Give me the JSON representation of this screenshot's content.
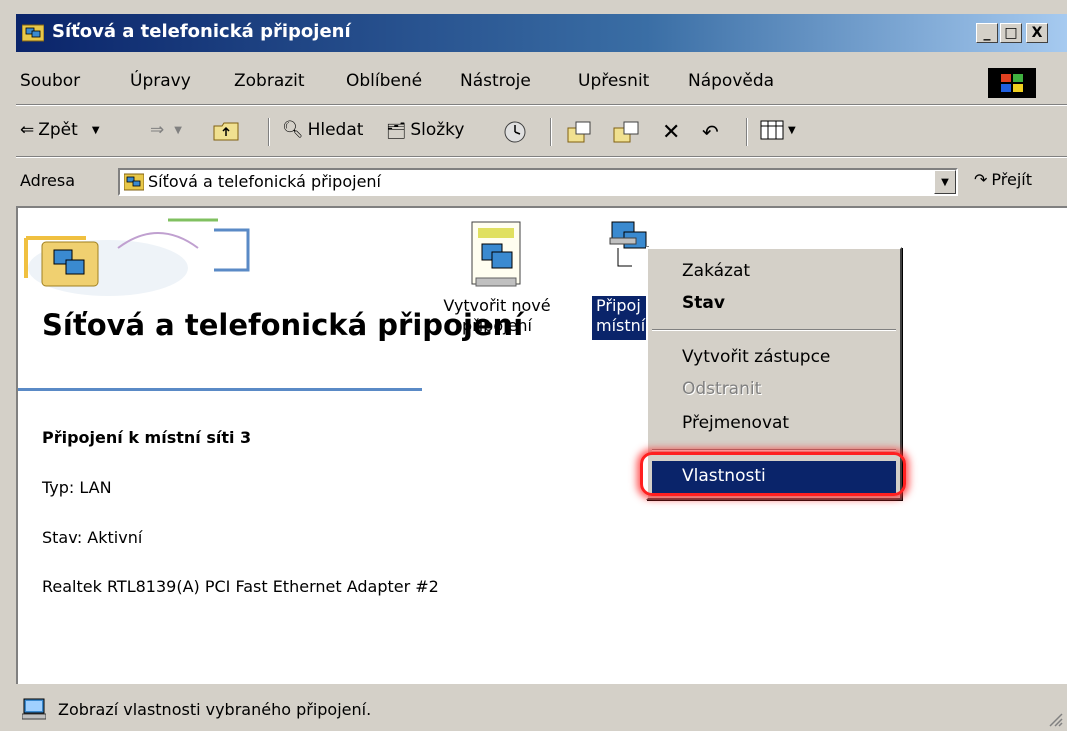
{
  "window": {
    "title": "Síťová a telefonická připojení",
    "minimize": "_",
    "maximize": "□",
    "close": "X"
  },
  "menu": [
    "Soubor",
    "Úpravy",
    "Zobrazit",
    "Oblíbené",
    "Nástroje",
    "Upřesnit",
    "Nápověda"
  ],
  "toolbar": {
    "back": "Zpět",
    "search": "Hledat",
    "folders": "Složky"
  },
  "address": {
    "label": "Adresa",
    "value": "Síťová a telefonická připojení",
    "go": "Přejít"
  },
  "panel": {
    "heading": "Síťová a telefonická připojení",
    "connection_name": "Připojení k místní síti 3",
    "type": "Typ: LAN",
    "state": "Stav: Aktivní",
    "adapter": "Realtek RTL8139(A) PCI Fast Ethernet Adapter #2"
  },
  "icons": {
    "new_connection": "Vytvořit nové připojení",
    "local_connection_line1": "Připoj",
    "local_connection_line2": "místní"
  },
  "context_menu": {
    "disable": "Zakázat",
    "status": "Stav",
    "create_shortcut": "Vytvořit zástupce",
    "delete": "Odstranit",
    "rename": "Přejmenovat",
    "properties": "Vlastnosti"
  },
  "status_bar": {
    "text": "Zobrazí vlastnosti vybraného připojení."
  },
  "colors": {
    "title_bar": "#0a246a",
    "selection": "#0a246a",
    "highlight_ring": "#ff2020",
    "face": "#d4d0c8"
  }
}
